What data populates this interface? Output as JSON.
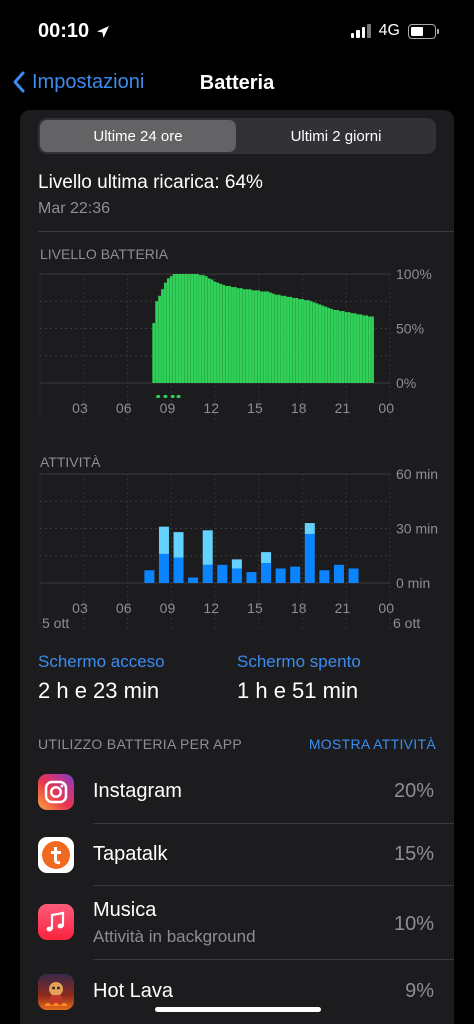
{
  "status_bar": {
    "time": "00:10",
    "network": "4G"
  },
  "nav": {
    "back_label": "Impostazioni",
    "title": "Batteria"
  },
  "segment": {
    "options": [
      "Ultime 24 ore",
      "Ultimi 2 giorni"
    ],
    "selected": 0
  },
  "last_charge": {
    "label": "Livello ultima ricarica: 64%",
    "date": "Mar 22:36"
  },
  "battery_section": {
    "title": "LIVELLO BATTERIA"
  },
  "activity_section": {
    "title": "ATTIVITÀ"
  },
  "chart_data": [
    {
      "type": "bar",
      "title": "LIVELLO BATTERIA",
      "x_tick_labels": [
        "03",
        "06",
        "09",
        "12",
        "15",
        "18",
        "21",
        "00"
      ],
      "y_tick_labels": [
        "100%",
        "50%",
        "0%"
      ],
      "ylim": [
        0,
        100
      ],
      "x_range_hours": [
        1.0,
        25.0
      ],
      "series": [
        {
          "x_hours": [
            8.8,
            9.0,
            9.2,
            9.4,
            9.6,
            9.8,
            10.0,
            10.2,
            10.4,
            10.6,
            10.8,
            11.0,
            11.2,
            11.4,
            11.6,
            11.8,
            12.0,
            12.2,
            12.4,
            12.6,
            12.8,
            13.0,
            13.2,
            13.4,
            13.6,
            13.8,
            14.0,
            14.2,
            14.4,
            14.6,
            14.8,
            15.0,
            15.2,
            15.4,
            15.6,
            15.8,
            16.0,
            16.2,
            16.4,
            16.6,
            16.8,
            17.0,
            17.2,
            17.4,
            17.6,
            17.8,
            18.0,
            18.2,
            18.4,
            18.6,
            18.8,
            19.0,
            19.2,
            19.4,
            19.6,
            19.8,
            20.0,
            20.2,
            20.4,
            20.6,
            20.8,
            21.0,
            21.2,
            21.4,
            21.6,
            21.8,
            22.0,
            22.2,
            22.4,
            22.6,
            22.8,
            23.0,
            23.2,
            23.4,
            23.6,
            23.8
          ],
          "values": [
            55,
            75,
            80,
            86,
            92,
            96,
            98,
            100,
            100,
            100,
            100,
            100,
            100,
            100,
            100,
            100,
            99,
            99,
            98,
            96,
            95,
            93,
            92,
            91,
            90,
            89,
            89,
            88,
            88,
            87,
            87,
            86,
            86,
            86,
            85,
            85,
            85,
            84,
            84,
            84,
            83,
            82,
            81,
            81,
            80,
            80,
            79,
            79,
            78,
            78,
            77,
            77,
            76,
            76,
            75,
            74,
            73,
            72,
            71,
            70,
            69,
            68,
            67,
            67,
            66,
            66,
            65,
            65,
            64,
            64,
            63,
            63,
            62,
            62,
            61,
            61
          ]
        }
      ],
      "low_power_markers_hours": [
        9.1,
        9.6,
        10.1,
        10.5
      ]
    },
    {
      "type": "bar",
      "title": "ATTIVITÀ",
      "x_tick_labels": [
        "03",
        "06",
        "09",
        "12",
        "15",
        "18",
        "21",
        "00"
      ],
      "date_labels": [
        "5 ott",
        "6 ott"
      ],
      "y_tick_labels": [
        "60 min",
        "30 min",
        "0 min"
      ],
      "ylim": [
        0,
        60
      ],
      "x_range_hours": [
        1.0,
        25.0
      ],
      "x_hours": [
        8.5,
        9.5,
        10.5,
        11.5,
        12.5,
        13.5,
        14.5,
        15.5,
        16.5,
        17.5,
        18.5,
        19.5,
        20.5,
        21.5,
        22.5
      ],
      "series": [
        {
          "name": "Schermo acceso",
          "color": "#0a84ff",
          "values": [
            7,
            16,
            14,
            3,
            10,
            10,
            8,
            6,
            11,
            8,
            9,
            27,
            7,
            10,
            8
          ]
        },
        {
          "name": "Schermo spento",
          "color": "#64d2ff",
          "values": [
            0,
            15,
            14,
            0,
            19,
            0,
            5,
            0,
            6,
            0,
            0,
            6,
            0,
            0,
            0
          ]
        }
      ]
    }
  ],
  "usage": {
    "screen_on_label": "Schermo acceso",
    "screen_on_value": "2 h e 23 min",
    "screen_off_label": "Schermo spento",
    "screen_off_value": "1 h e 51 min"
  },
  "app_usage": {
    "header": "UTILIZZO BATTERIA PER APP",
    "action": "MOSTRA ATTIVITÀ",
    "apps": [
      {
        "name": "Instagram",
        "subtitle": "",
        "percent": "20%",
        "icon": "instagram-icon"
      },
      {
        "name": "Tapatalk",
        "subtitle": "",
        "percent": "15%",
        "icon": "tapatalk-icon"
      },
      {
        "name": "Musica",
        "subtitle": "Attività in background",
        "percent": "10%",
        "icon": "music-icon"
      },
      {
        "name": "Hot Lava",
        "subtitle": "",
        "percent": "9%",
        "icon": "hot-lava-icon"
      }
    ]
  }
}
